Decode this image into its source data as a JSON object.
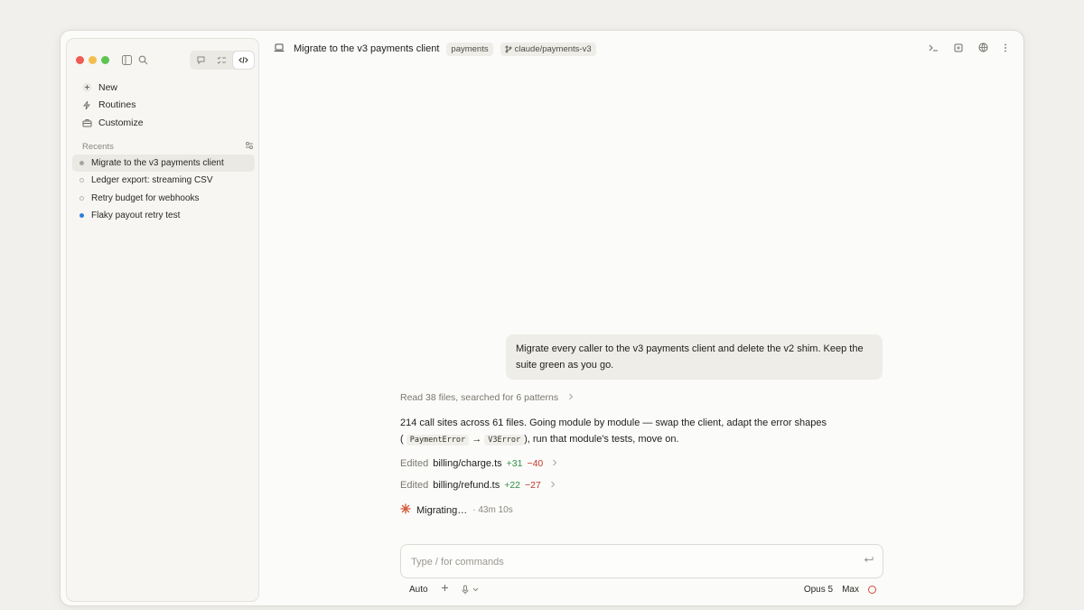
{
  "sidebar": {
    "nav": [
      {
        "label": "New",
        "icon": "plus-icon"
      },
      {
        "label": "Routines",
        "icon": "bolt-icon"
      },
      {
        "label": "Customize",
        "icon": "toolbox-icon"
      }
    ],
    "recents_label": "Recents",
    "recents": [
      {
        "label": "Migrate to the v3 payments client",
        "status": "active"
      },
      {
        "label": "Ledger export: streaming CSV",
        "status": "idle"
      },
      {
        "label": "Retry budget for webhooks",
        "status": "idle"
      },
      {
        "label": "Flaky payout retry test",
        "status": "running"
      }
    ]
  },
  "header": {
    "title": "Migrate to the v3 payments client",
    "repo": "payments",
    "branch": "claude/payments-v3"
  },
  "conversation": {
    "user_message": "Migrate every caller to the v3 payments client and delete the v2 shim. Keep the suite green as you go.",
    "tool_summary": "Read 38 files, searched for 6 patterns",
    "assistant_line1": "214 call sites across 61 files. Going module by module — swap the client, adapt the error shapes",
    "assistant_open": "(",
    "code_from": "PaymentError",
    "arrow": "→",
    "code_to": "V3Error",
    "assistant_line2_rest": "), run that module's tests, move on.",
    "edits": [
      {
        "label": "Edited",
        "file": "billing/charge.ts",
        "add": "+31",
        "del": "−40"
      },
      {
        "label": "Edited",
        "file": "billing/refund.ts",
        "add": "+22",
        "del": "−27"
      }
    ],
    "status": "Migrating…",
    "elapsed": "· 43m 10s"
  },
  "composer": {
    "placeholder": "Type / for commands",
    "mode": "Auto",
    "model": "Opus 5",
    "effort": "Max"
  },
  "colors": {
    "accent_running": "#2f7ddb",
    "add": "#2f8f44",
    "del": "#c0392b",
    "spinner": "#d2593a"
  }
}
